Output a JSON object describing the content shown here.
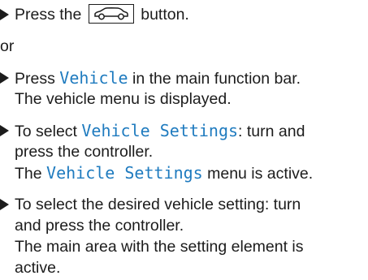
{
  "steps": [
    {
      "before": "Press the",
      "icon": "car-icon",
      "after": "button."
    }
  ],
  "or_text": "or",
  "step2": {
    "before": "Press",
    "highlight": "Vehicle",
    "after": "in the main function bar.",
    "result": "The vehicle menu is displayed."
  },
  "step3": {
    "before": "To select",
    "highlight": "Vehicle Settings",
    "after": ": turn and",
    "line2": "press the controller.",
    "result_before": "The",
    "result_highlight": "Vehicle Settings",
    "result_after": "menu is active."
  },
  "step4": {
    "line1": "To select the desired vehicle setting: turn",
    "line2": "and press the controller.",
    "result_line1": "The main area with the setting element is",
    "result_line2": "active."
  },
  "colors": {
    "text": "#1c1c1c",
    "highlight": "#1f7bbf"
  }
}
